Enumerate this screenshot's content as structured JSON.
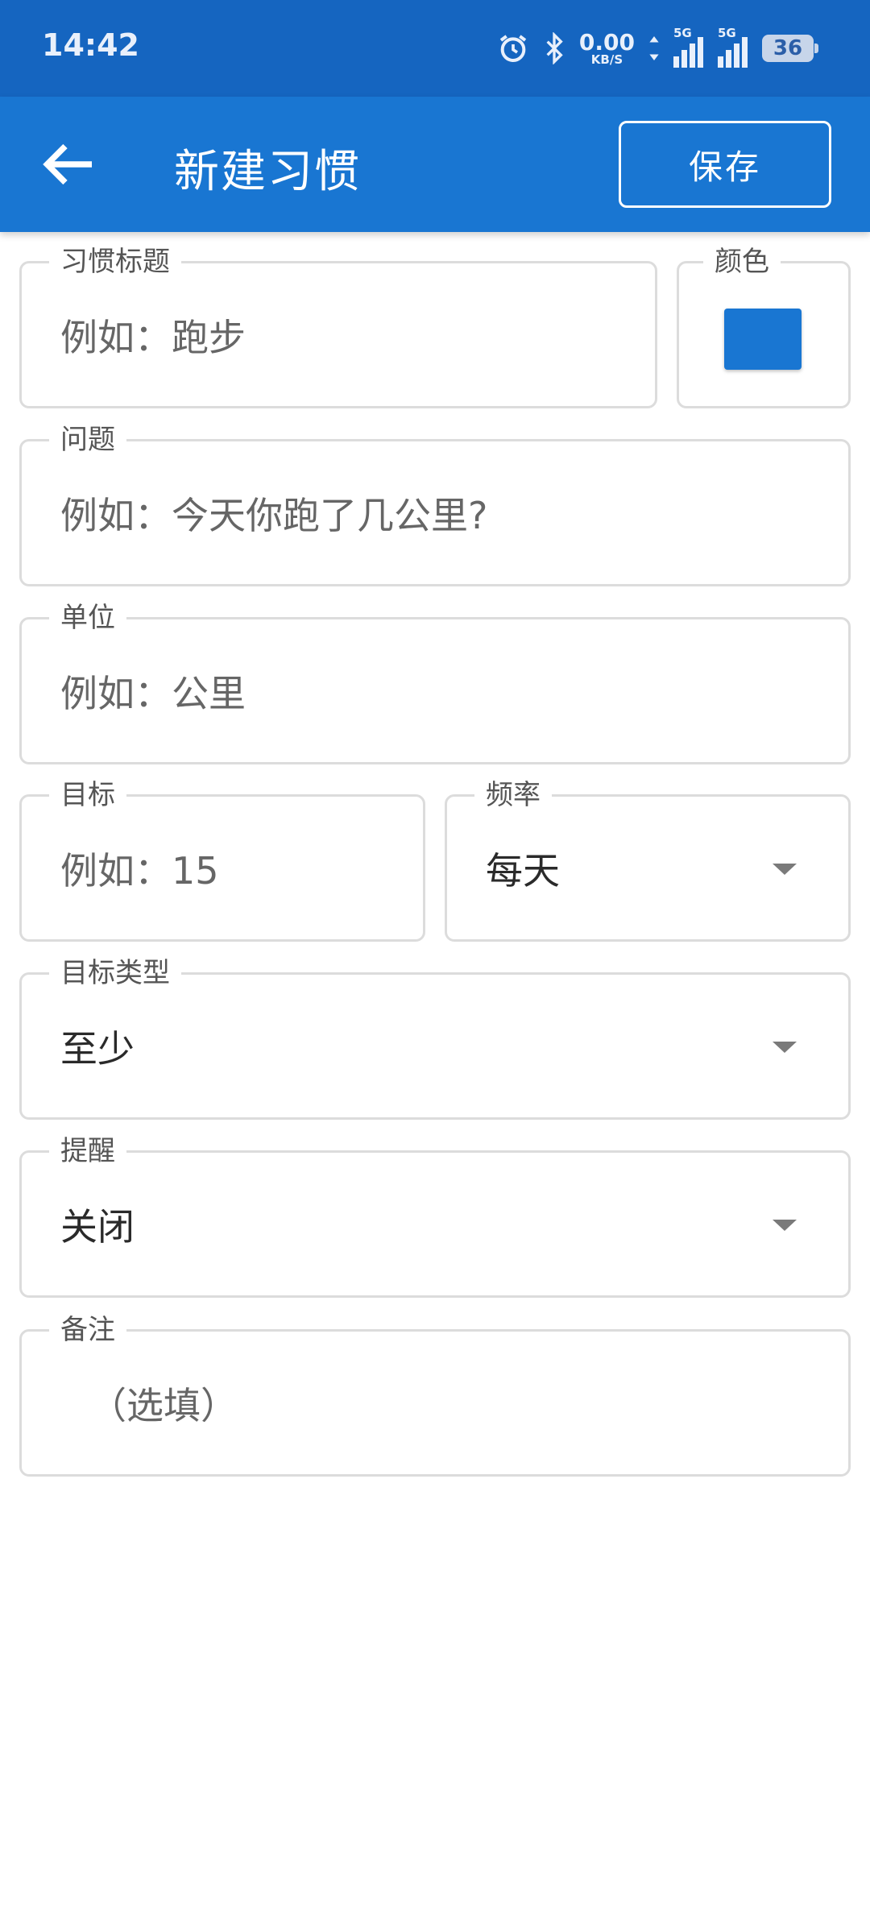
{
  "status_bar": {
    "time": "14:42",
    "net_speed_value": "0.00",
    "net_speed_unit": "KB/S",
    "signal1_label": "5G",
    "signal2_label": "5G",
    "battery": "36"
  },
  "app_bar": {
    "title": "新建习惯",
    "save_label": "保存"
  },
  "form": {
    "habit_title": {
      "label": "习惯标题",
      "placeholder": "例如：跑步"
    },
    "color": {
      "label": "颜色",
      "value_color": "#1976D2"
    },
    "question": {
      "label": "问题",
      "placeholder": "例如：今天你跑了几公里?"
    },
    "unit": {
      "label": "单位",
      "placeholder": "例如：公里"
    },
    "target": {
      "label": "目标",
      "placeholder": "例如：15"
    },
    "frequency": {
      "label": "频率",
      "value": "每天"
    },
    "target_type": {
      "label": "目标类型",
      "value": "至少"
    },
    "reminder": {
      "label": "提醒",
      "value": "关闭"
    },
    "notes": {
      "label": "备注",
      "placeholder": "（选填）"
    }
  },
  "colors": {
    "status_bar": "#1565C0",
    "app_bar": "#1976D2",
    "border": "#dcdcdc"
  }
}
